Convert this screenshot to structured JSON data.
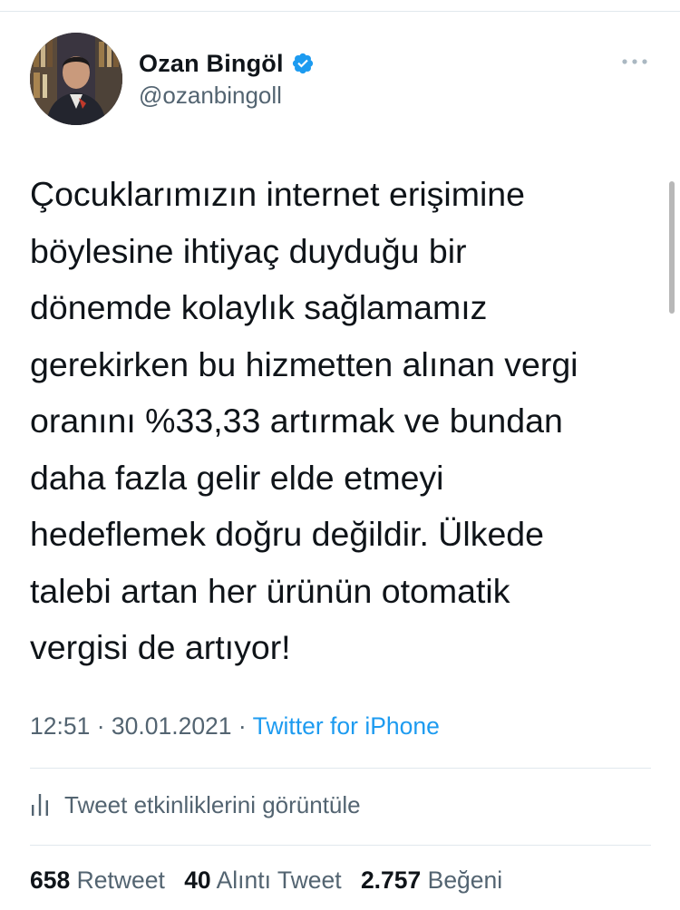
{
  "author": {
    "name": "Ozan Bingöl",
    "handle": "@ozanbingoll",
    "verified_icon": "verified-badge-icon",
    "avatar_icon": "profile-photo"
  },
  "more_icon": "more-options-icon",
  "tweet": {
    "lines": [
      "Çocuklarımızın internet erişimine",
      "böylesine ihtiyaç duyduğu bir",
      "dönemde kolaylık sağlamamız",
      "gerekirken bu hizmetten alınan vergi",
      "oranını %33,33 artırmak ve bundan",
      "daha fazla gelir elde etmeyi",
      "hedeflemek doğru değildir. Ülkede",
      "talebi artan her ürünün otomatik",
      "vergisi de artıyor!"
    ]
  },
  "meta": {
    "time": "12:51",
    "separator": "·",
    "date": "30.01.2021",
    "source": "Twitter for iPhone"
  },
  "activity": {
    "icon": "analytics-bars-icon",
    "label": "Tweet etkinliklerini görüntüle"
  },
  "stats": {
    "retweets_count": "658",
    "retweets_label": "Retweet",
    "quotes_count": "40",
    "quotes_label": "Alıntı Tweet",
    "likes_count": "2.757",
    "likes_label": "Beğeni"
  },
  "colors": {
    "link": "#1d9bf0",
    "secondary_text": "#536471",
    "primary_text": "#0f1419",
    "divider": "#e1e8ed"
  }
}
